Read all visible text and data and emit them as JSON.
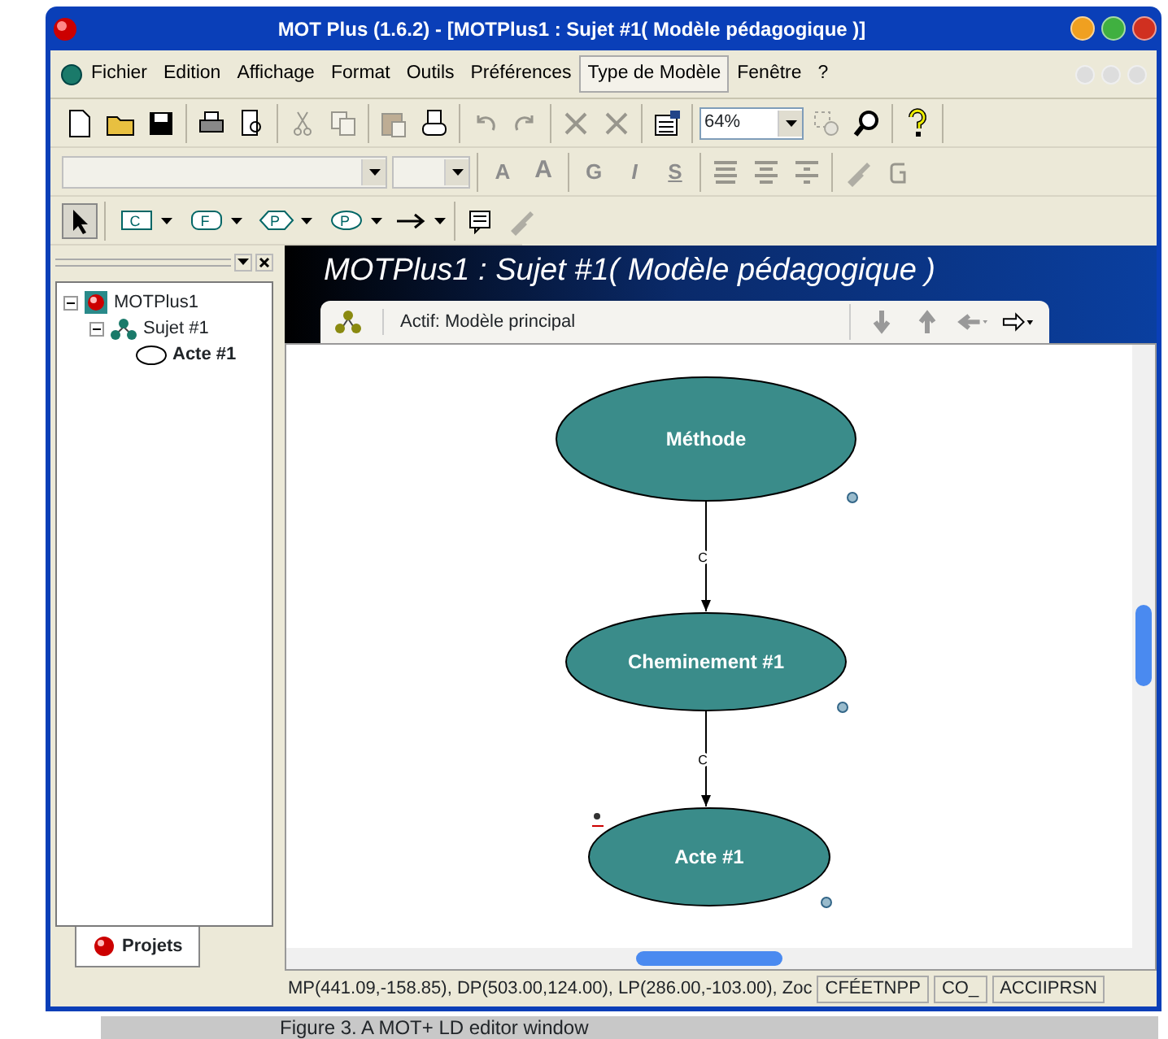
{
  "window": {
    "title": "MOT Plus (1.6.2) - [MOTPlus1 : Sujet #1( Modèle pédagogique )]"
  },
  "menu": [
    {
      "label": "Fichier",
      "selected": false
    },
    {
      "label": "Edition",
      "selected": false
    },
    {
      "label": "Affichage",
      "selected": false
    },
    {
      "label": "Format",
      "selected": false
    },
    {
      "label": "Outils",
      "selected": false
    },
    {
      "label": "Préférences",
      "selected": false
    },
    {
      "label": "Type de Modèle",
      "selected": true
    },
    {
      "label": "Fenêtre",
      "selected": false
    },
    {
      "label": "?",
      "selected": false
    }
  ],
  "toolbar_main": [
    {
      "disabled": false
    },
    {
      "disabled": false
    },
    {
      "disabled": false
    },
    {
      "disabled": false
    },
    {
      "disabled": false
    },
    {
      "disabled": true
    },
    {
      "disabled": true
    },
    {
      "disabled": true
    },
    {
      "disabled": false
    },
    {
      "disabled": true
    },
    {
      "disabled": true
    },
    {
      "disabled": true
    },
    {
      "disabled": true
    },
    {
      "disabled": false
    }
  ],
  "zoom": {
    "value": "64%"
  },
  "toolbar_zoom": [
    {
      "disabled": true
    },
    {
      "disabled": false
    },
    {
      "disabled": false
    }
  ],
  "toolbar_format": [
    {
      "label": "A",
      "disabled": true
    },
    {
      "label": "A",
      "disabled": true
    },
    {
      "label": "G",
      "disabled": true
    },
    {
      "label": "I",
      "disabled": true
    },
    {
      "label": "S",
      "disabled": true
    }
  ],
  "toolbar_shapes": [
    {
      "kind": "pointer",
      "selected": true
    },
    {
      "kind": "rect",
      "label": "C",
      "selected": false
    },
    {
      "kind": "rounded",
      "label": "F",
      "selected": false
    },
    {
      "kind": "hexagon",
      "label": "P",
      "selected": false
    },
    {
      "kind": "oval",
      "label": "P",
      "selected": false
    },
    {
      "kind": "arrow",
      "selected": false
    }
  ],
  "tree": [
    {
      "label": "MOTPlus1",
      "expanded": true,
      "selected": false,
      "children": [
        {
          "label": "Sujet #1",
          "expanded": true,
          "selected": false,
          "children": [
            {
              "label": "Acte #1",
              "selected": true
            }
          ]
        }
      ]
    }
  ],
  "left_tab": {
    "label": "Projets"
  },
  "document": {
    "title": "MOTPlus1 : Sujet #1( Modèle pédagogique )",
    "tab": "Actif: Modèle principal"
  },
  "diagram": {
    "nodes": [
      {
        "label": "Méthode"
      },
      {
        "label": "Cheminement #1"
      },
      {
        "label": "Acte #1"
      }
    ],
    "links": [
      {
        "label": "C"
      },
      {
        "label": "C"
      }
    ]
  },
  "status_bar": {
    "coords": "MP(441.09,-158.85), DP(503.00,124.00), LP(286.00,-103.00), Zoc",
    "fields": [
      "CFÉETNPP",
      "CO_",
      "ACCIIPRSN"
    ]
  },
  "caption": "Figure 3. A MOT+ LD editor window"
}
